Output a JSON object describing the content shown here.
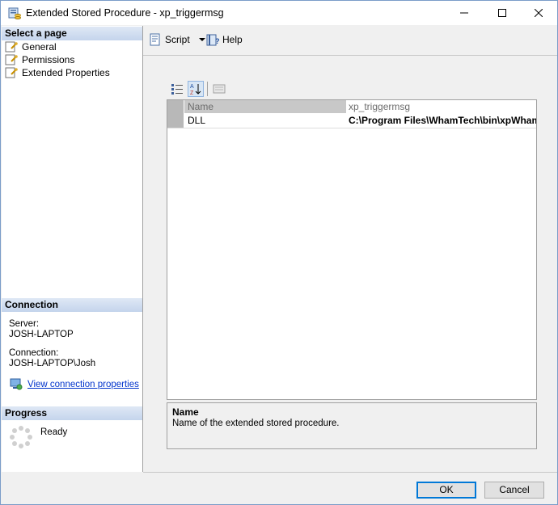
{
  "window": {
    "title": "Extended Stored Procedure - xp_triggermsg"
  },
  "sidebar": {
    "select_page_header": "Select a page",
    "pages": [
      {
        "label": "General",
        "selected": true
      },
      {
        "label": "Permissions",
        "selected": false
      },
      {
        "label": "Extended Properties",
        "selected": false
      }
    ],
    "connection_header": "Connection",
    "server_label": "Server:",
    "server_value": "JOSH-LAPTOP",
    "connection_label": "Connection:",
    "connection_value": "JOSH-LAPTOP\\Josh",
    "view_connection_link": "View connection properties",
    "progress_header": "Progress",
    "progress_status": "Ready"
  },
  "toolbar": {
    "script_label": "Script",
    "help_label": "Help"
  },
  "property_grid": {
    "rows": [
      {
        "name": "Name",
        "value": "xp_triggermsg",
        "readonly": true
      },
      {
        "name": "DLL",
        "value": "C:\\Program Files\\WhamTech\\bin\\xpWhamTech",
        "readonly": false
      }
    ]
  },
  "description": {
    "title": "Name",
    "text": "Name of the extended stored procedure."
  },
  "buttons": {
    "ok": "OK",
    "cancel": "Cancel"
  },
  "colors": {
    "accent": "#0078d7",
    "header_gradient_top": "#dfe8f5",
    "header_gradient_bottom": "#c4d4ec",
    "link": "#0033cc"
  }
}
